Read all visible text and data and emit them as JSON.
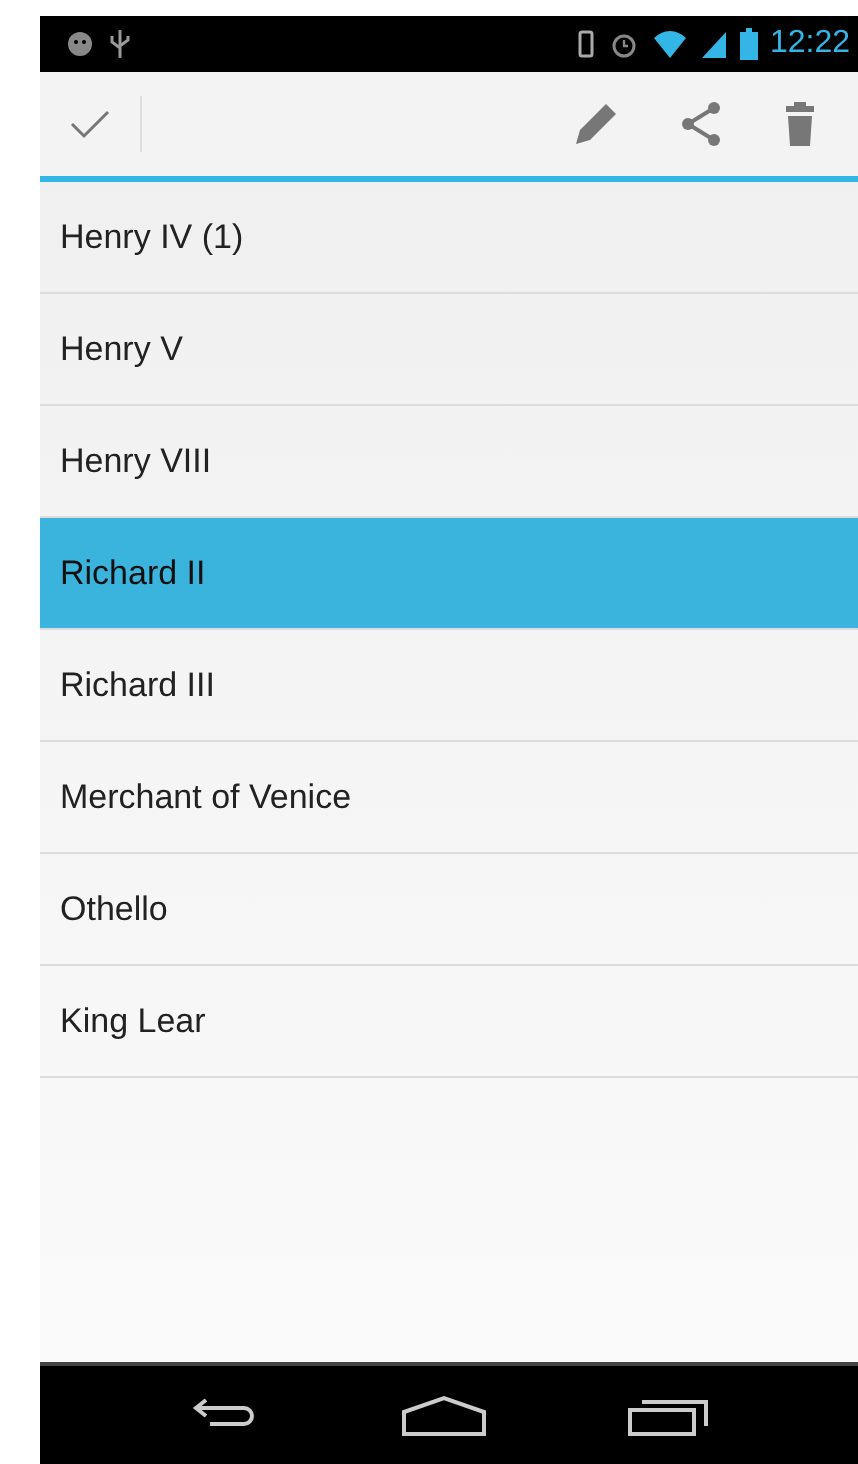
{
  "status_bar": {
    "time": "12:22"
  },
  "items": [
    {
      "title": "Henry IV (1)",
      "selected": false
    },
    {
      "title": "Henry V",
      "selected": false
    },
    {
      "title": "Henry VIII",
      "selected": false
    },
    {
      "title": "Richard II",
      "selected": true
    },
    {
      "title": "Richard III",
      "selected": false
    },
    {
      "title": "Merchant of Venice",
      "selected": false
    },
    {
      "title": "Othello",
      "selected": false
    },
    {
      "title": "King Lear",
      "selected": false
    }
  ]
}
